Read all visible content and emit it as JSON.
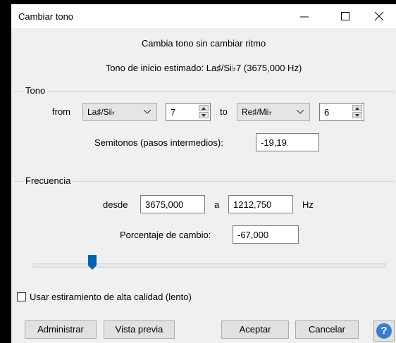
{
  "window": {
    "title": "Cambiar tono"
  },
  "header": {
    "description": "Cambia tono sin cambiar ritmo",
    "estimate": "Tono de inicio estimado: La♯/Si♭7 (3675,000 Hz)"
  },
  "tono": {
    "group_label": "Tono",
    "from_label": "from",
    "from_note": "La♯/Si♭",
    "from_octave": "7",
    "to_label": "to",
    "to_note": "Re♯/Mi♭",
    "to_octave": "6",
    "semitones_label": "Semitonos (pasos intermedios):",
    "semitones_value": "-19,19"
  },
  "frecuencia": {
    "group_label": "Frecuencia",
    "desde_label": "desde",
    "desde_value": "3675,000",
    "a_label": "a",
    "a_value": "1212,750",
    "unit": "Hz",
    "percent_label": "Porcentaje de cambio:",
    "percent_value": "-67,000"
  },
  "slider": {
    "level_fraction": 0.2
  },
  "options": {
    "high_quality_label": "Usar estiramiento de alta calidad (lento)",
    "high_quality_checked": false
  },
  "buttons": {
    "manage": "Administrar",
    "preview": "Vista previa",
    "accept": "Aceptar",
    "cancel": "Cancelar",
    "help": "?"
  },
  "colors": {
    "dialog_bg": "#f0f0f0",
    "thumb": "#0063b1",
    "help": "#3a7bd5"
  },
  "icons": [
    "minimize-icon",
    "maximize-icon",
    "close-icon",
    "chevron-down-icon",
    "spin-up-icon",
    "spin-down-icon",
    "help-icon"
  ]
}
